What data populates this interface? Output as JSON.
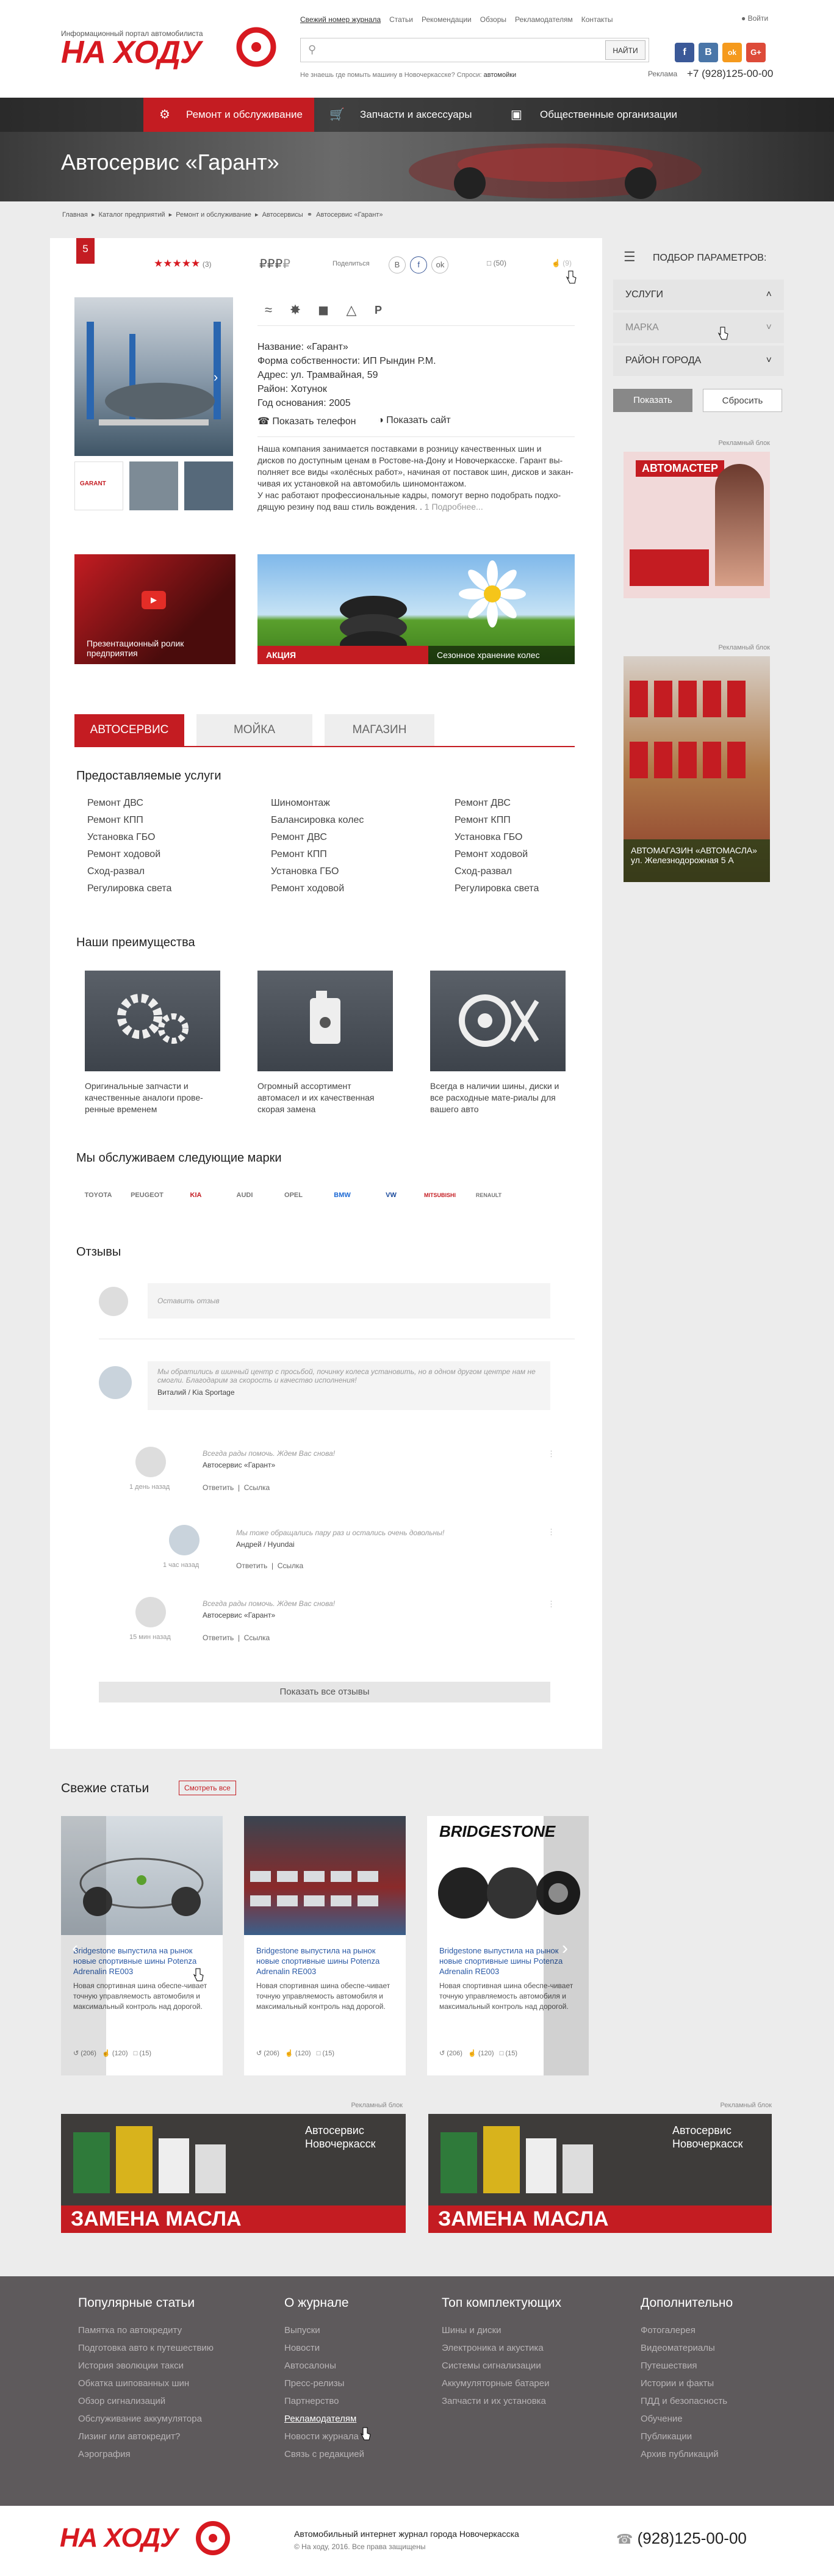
{
  "header": {
    "tagline": "Информационный портал автомобилиста",
    "logo": "НА ХОДУ",
    "topnav": [
      "Свежий номер журнала",
      "Статьи",
      "Рекомендации",
      "Обзоры",
      "Рекламодателям",
      "Контакты"
    ],
    "login": "Войти",
    "search_placeholder": "",
    "find": "НАЙТИ",
    "hint": "Не знаешь где помыть машину в Новочеркасске? Спроси:",
    "hint_link": "автомойки",
    "social": [
      "f",
      "B",
      "ok",
      "G+"
    ],
    "ad_label": "Реклама",
    "phone": "+7 (928)125-00-00"
  },
  "hero": {
    "categories": [
      "Ремонт и обслуживание",
      "Запчасти и аксессуары",
      "Общественные организации"
    ],
    "title": "Автосервис «Гарант»"
  },
  "crumbs": [
    "Главная",
    "Каталог предприятий",
    "Ремонт и обслуживание",
    "Автосервисы",
    "Автосервис «Гарант»"
  ],
  "rating": {
    "badge": "5",
    "stars": "★★★",
    "stars_off": "★★",
    "count": "(3)",
    "rubles": "₽₽₽",
    "rubles_off": "₽",
    "share": "Поделиться",
    "share_btns": [
      "B",
      "f",
      "ok"
    ],
    "comments": "(50)",
    "likes": "(9)"
  },
  "amenities": [
    "wifi",
    "food",
    "car-wash",
    "gas",
    "parking"
  ],
  "info": {
    "name_l": "Название:",
    "name": "«Гарант»",
    "form_l": "Форма собственности:",
    "form": "ИП Рындин Р.М.",
    "addr_l": "Адрес:",
    "addr": "ул. Трамвайная, 59",
    "dist_l": "Район:",
    "dist": "Хотунок",
    "year_l": "Год основания:",
    "year": "2005",
    "btn_phone": "Показать телефон",
    "btn_site": "Показать сайт"
  },
  "desc": [
    "Наша компания занимается поставками в розницу качественных шин и",
    "дисков по доступным ценам в Ростове-на-Дону и Новочеркасске. Гарант вы-",
    "полняет все виды «колёсных работ», начиная от поставок шин, дисков и закан-",
    "чивая их установкой на автомобиль шиномонтажом.",
    "У нас работают профессиональные кадры, помогут верно подобрать подхо-",
    "дящую резину под ваш стиль вождения. ."
  ],
  "desc_more": "1 Подробнее...",
  "promo": {
    "video": "Презентационный ролик предприятия",
    "action": "АКЦИЯ",
    "season": "Сезонное хранение колес"
  },
  "tabs": [
    "АВТОСЕРВИС",
    "МОЙКА",
    "МАГАЗИН"
  ],
  "services": {
    "title": "Предоставляемые услуги",
    "col1": [
      "Ремонт ДВС",
      "Ремонт КПП",
      "Установка ГБО",
      "Ремонт ходовой",
      "Сход-развал",
      "Регулировка света"
    ],
    "col2": [
      "Шиномонтаж",
      "Балансировка колес",
      "Ремонт ДВС",
      "Ремонт КПП",
      "Установка ГБО",
      "Ремонт ходовой"
    ],
    "col3": [
      "Ремонт ДВС",
      "Ремонт КПП",
      "Установка ГБО",
      "Ремонт ходовой",
      "Сход-развал",
      "Регулировка света"
    ]
  },
  "advantages": {
    "title": "Наши преимущества",
    "items": [
      "Оригинальные запчасти и качественные аналоги прове-ренные временем",
      "Огромный ассортимент автомасел и их качественная скорая замена",
      "Всегда в наличии шины, диски и все расходные мате-риалы для вашего авто"
    ]
  },
  "brands": {
    "title": "Мы обслуживаем следующие марки",
    "items": [
      "TOYOTA",
      "PEUGEOT",
      "KIA",
      "AUDI",
      "OPEL",
      "BMW",
      "VW",
      "MITSUBISHI",
      "RENAULT"
    ]
  },
  "reviews": {
    "title": "Отзывы",
    "placeholder": "Оставить отзыв",
    "r1_text": "Мы обратились в шинный центр с просьбой, починку колеса установить, но в одном другом центре нам не смогли. Благодарим за скорость и качество исполнения!",
    "r1_author": "Виталий / Kia Sportage",
    "r2_text": "Всегда рады помочь. Ждем Вас снова!",
    "r2_author": "Автосервис «Гарант»",
    "r2_time": "1 день назад",
    "r3_text": "Мы тоже обращались пару раз и остались очень довольны!",
    "r3_author": "Андрей / Hyundai",
    "r3_time": "1 час назад",
    "r4_text": "Всегда рады помочь. Ждем Вас снова!",
    "r4_author": "Автосервис «Гарант»",
    "r4_time": "15 мин назад",
    "reply": "Ответить",
    "link": "Ссылка",
    "showall": "Показать все отзывы"
  },
  "sidebar": {
    "title": "ПОДБОР ПАРАМЕТРОВ:",
    "filters": [
      "УСЛУГИ",
      "МАРКА",
      "РАЙОН ГОРОДА"
    ],
    "show": "Показать",
    "reset": "Сбросить",
    "ad_label": "Рекламный блок",
    "ad1_title": "АВТОМАСТЕР",
    "ad2_title": "АВТОМАГАЗИН «АВТОМАСЛА»",
    "ad2_addr": "ул. Железнодорожная 5 А"
  },
  "articles": {
    "title": "Свежие статьи",
    "all": "Смотреть все",
    "items": [
      {
        "t": "Bridgestone выпустила на рынок новые спортивные шины Potenza Adrenalin RE003",
        "d": "Новая спортивная шина обеспе-чивает точную управляемость автомобиля и максимальный контроль над дорогой.",
        "c1": "(206)",
        "c2": "(120)",
        "c3": "(15)"
      },
      {
        "t": "Bridgestone выпустила на рынок новые спортивные шины Potenza Adrenalin RE003",
        "d": "Новая спортивная шина обеспе-чивает точную управляемость автомобиля и максимальный контроль над дорогой.",
        "c1": "(206)",
        "c2": "(120)",
        "c3": "(15)"
      },
      {
        "t": "Bridgestone выпустила на рынок новые спортивные шины Potenza Adrenalin RE003",
        "d": "Новая спортивная шина обеспе-чивает точную управляемость автомобиля и максимальный контроль над дорогой.",
        "c1": "(206)",
        "c2": "(120)",
        "c3": "(15)"
      }
    ]
  },
  "banners": {
    "label": "Рекламный блок",
    "brand": "Автосервис Новочеркасск",
    "title": "ЗАМЕНА МАСЛА"
  },
  "footer": {
    "cols": [
      {
        "h": "Популярные статьи",
        "items": [
          "Памятка по автокредиту",
          "Подготовка авто к путешествию",
          "История эволюции такси",
          "Обкатка шипованных шин",
          "Обзор сигнализаций",
          "Обслуживание аккумулятора",
          "Лизинг или автокредит?",
          "Аэрография"
        ]
      },
      {
        "h": "О журнале",
        "items": [
          "Выпуски",
          "Новости",
          "Автосалоны",
          "Пресс-релизы",
          "Партнерство",
          "Рекламодателям",
          "Новости журнала",
          "Связь с редакцией"
        ]
      },
      {
        "h": "Топ комплектующих",
        "items": [
          "Шины и диски",
          "Электроника и акустика",
          "Системы сигнализации",
          "Аккумуляторные батареи",
          "Запчасти и их установка"
        ]
      },
      {
        "h": "Дополнительно",
        "items": [
          "Фотогалерея",
          "Видеоматериалы",
          "Путешествия",
          "Истории и факты",
          "ПДД и безопасность",
          "Обучение",
          "Публикации",
          "Архив публикаций"
        ]
      }
    ]
  },
  "bottom": {
    "logo": "НА ХОДУ",
    "desc": "Автомобильный интернет журнал города Новочеркасска",
    "copy": "© На ходу, 2016. Все права защищены",
    "phone": "(928)125-00-00"
  }
}
